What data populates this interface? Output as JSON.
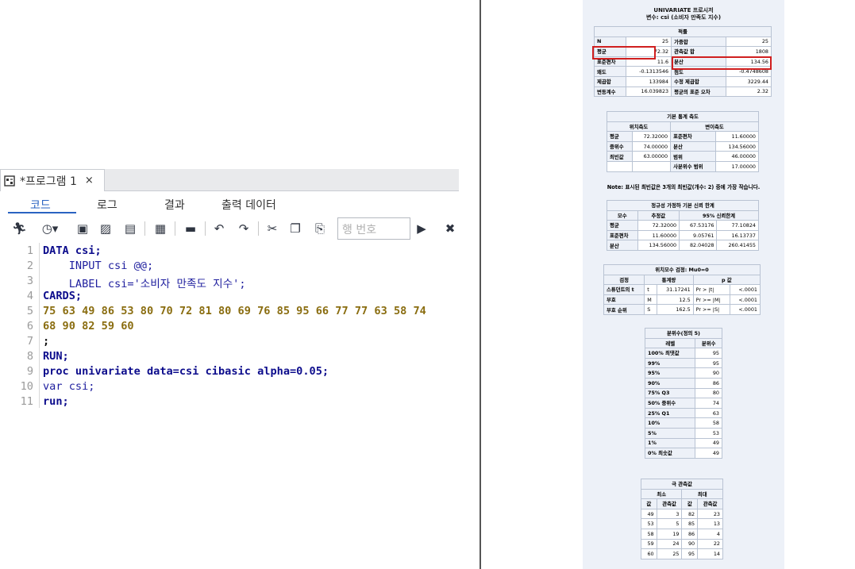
{
  "tab": {
    "title": "*프로그램 1",
    "close": "×"
  },
  "subtabs": [
    "코드",
    "로그",
    "결과",
    "출력 데이터"
  ],
  "line_input": {
    "placeholder": "행 번호"
  },
  "code_lines": [
    {
      "n": "1",
      "text": "DATA csi;"
    },
    {
      "n": "2",
      "text": "    INPUT csi @@;"
    },
    {
      "n": "3",
      "text": "    LABEL csi='소비자 만족도 지수';"
    },
    {
      "n": "4",
      "text": "CARDS;"
    },
    {
      "n": "5",
      "text": "75 63 49 86 53 80 70 72 81 80 69 76 85 95 66 77 77 63 58 74"
    },
    {
      "n": "6",
      "text": "68 90 82 59 60"
    },
    {
      "n": "7",
      "text": ";"
    },
    {
      "n": "8",
      "text": "RUN;"
    },
    {
      "n": "9",
      "text": "proc univariate data=csi cibasic alpha=0.05;"
    },
    {
      "n": "10",
      "text": "var csi;"
    },
    {
      "n": "11",
      "text": "run;"
    }
  ],
  "report": {
    "title": "UNIVARIATE 프로시저",
    "subtitle": "변수: csi (소비자 만족도 지수)",
    "moments": {
      "header": "적률",
      "rows": [
        [
          "N",
          "25",
          "가중합",
          "25"
        ],
        [
          "평균",
          "72.32",
          "관측값 합",
          "1808"
        ],
        [
          "표준편차",
          "11.6",
          "분산",
          "134.56"
        ],
        [
          "왜도",
          "-0.1313546",
          "첨도",
          "-0.4748608"
        ],
        [
          "제곱합",
          "133984",
          "수정 제곱합",
          "3229.44"
        ],
        [
          "변동계수",
          "16.039823",
          "평균의 표준 오차",
          "2.32"
        ]
      ]
    },
    "basic": {
      "header": "기본 통계 측도",
      "col1": "위치측도",
      "col2": "변이측도",
      "rows": [
        [
          "평균",
          "72.32000",
          "표준편차",
          "11.60000"
        ],
        [
          "중위수",
          "74.00000",
          "분산",
          "134.56000"
        ],
        [
          "최빈값",
          "63.00000",
          "범위",
          "46.00000"
        ],
        [
          "",
          "",
          "사분위수 범위",
          "17.00000"
        ]
      ]
    },
    "note": "Note: 표시된 최빈값은 3개의 최빈값(개수: 2) 중에 가장 작습니다.",
    "ci": {
      "header": "정규성 가정하 기본 신뢰 한계",
      "cols": [
        "모수",
        "추정값",
        "95% 신뢰한계"
      ],
      "rows": [
        [
          "평균",
          "72.32000",
          "67.53176",
          "77.10824"
        ],
        [
          "표준편차",
          "11.60000",
          "9.05761",
          "16.13737"
        ],
        [
          "분산",
          "134.56000",
          "82.04028",
          "260.41455"
        ]
      ]
    },
    "loc": {
      "header": "위치모수 검정: Mu0=0",
      "cols": [
        "검정",
        "통계량",
        "p 값"
      ],
      "rows": [
        [
          "스튜던트의 t",
          "t",
          "31.17241",
          "Pr > |t|",
          "<.0001"
        ],
        [
          "부호",
          "M",
          "12.5",
          "Pr >= |M|",
          "<.0001"
        ],
        [
          "부호 순위",
          "S",
          "162.5",
          "Pr >= |S|",
          "<.0001"
        ]
      ]
    },
    "quant": {
      "header": "분위수(정의 5)",
      "cols": [
        "레벨",
        "분위수"
      ],
      "rows": [
        [
          "100% 최댓값",
          "95"
        ],
        [
          "99%",
          "95"
        ],
        [
          "95%",
          "90"
        ],
        [
          "90%",
          "86"
        ],
        [
          "75% Q3",
          "80"
        ],
        [
          "50% 중위수",
          "74"
        ],
        [
          "25% Q1",
          "63"
        ],
        [
          "10%",
          "58"
        ],
        [
          "5%",
          "53"
        ],
        [
          "1%",
          "49"
        ],
        [
          "0% 최솟값",
          "49"
        ]
      ]
    },
    "extreme": {
      "header": "극 관측값",
      "col1": "최소",
      "col2": "최대",
      "sub": [
        "값",
        "관측값",
        "값",
        "관측값"
      ],
      "rows": [
        [
          "49",
          "3",
          "82",
          "23"
        ],
        [
          "53",
          "5",
          "85",
          "13"
        ],
        [
          "58",
          "19",
          "86",
          "4"
        ],
        [
          "59",
          "24",
          "90",
          "22"
        ],
        [
          "60",
          "25",
          "95",
          "14"
        ]
      ]
    }
  }
}
